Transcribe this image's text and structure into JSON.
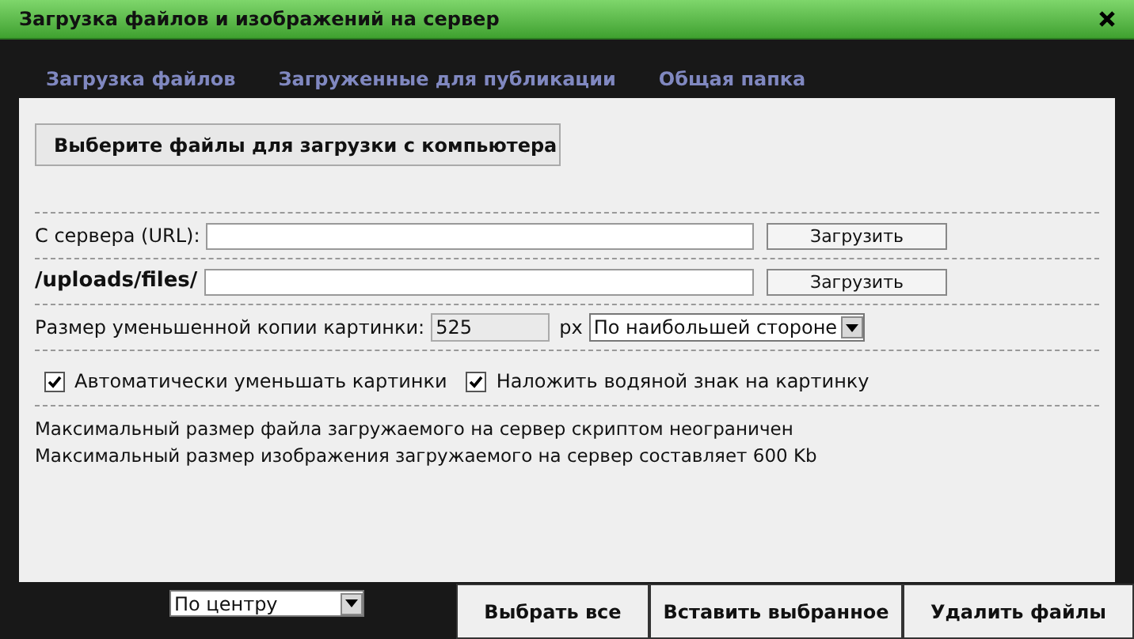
{
  "window": {
    "title": "Загрузка файлов и изображений на сервер"
  },
  "tabs": [
    {
      "label": "Загрузка файлов"
    },
    {
      "label": "Загруженные для публикации"
    },
    {
      "label": "Общая папка"
    }
  ],
  "choose_files_button": "Выберите файлы для загрузки с компьютера",
  "upload_rows": [
    {
      "label": "С сервера (URL):",
      "kind": "plain",
      "button": "Загрузить"
    },
    {
      "label": "/uploads/files/",
      "kind": "path",
      "button": "Загрузить"
    }
  ],
  "resize": {
    "label": "Размер уменьшенной копии картинки:",
    "value": "525",
    "unit": "px",
    "mode": "По наибольшей стороне"
  },
  "checkboxes": [
    {
      "label": "Автоматически уменьшать картинки",
      "checked": true
    },
    {
      "label": "Наложить водяной знак на картинку",
      "checked": true
    }
  ],
  "info": [
    "Максимальный размер файла загружаемого на сервер скриптом неограничен",
    "Максимальный размер изображения загружаемого на сервер составляет 600 Kb"
  ],
  "align_select": "По центру",
  "footer_buttons": [
    "Выбрать все",
    "Вставить выбранное",
    "Удалить файлы"
  ]
}
